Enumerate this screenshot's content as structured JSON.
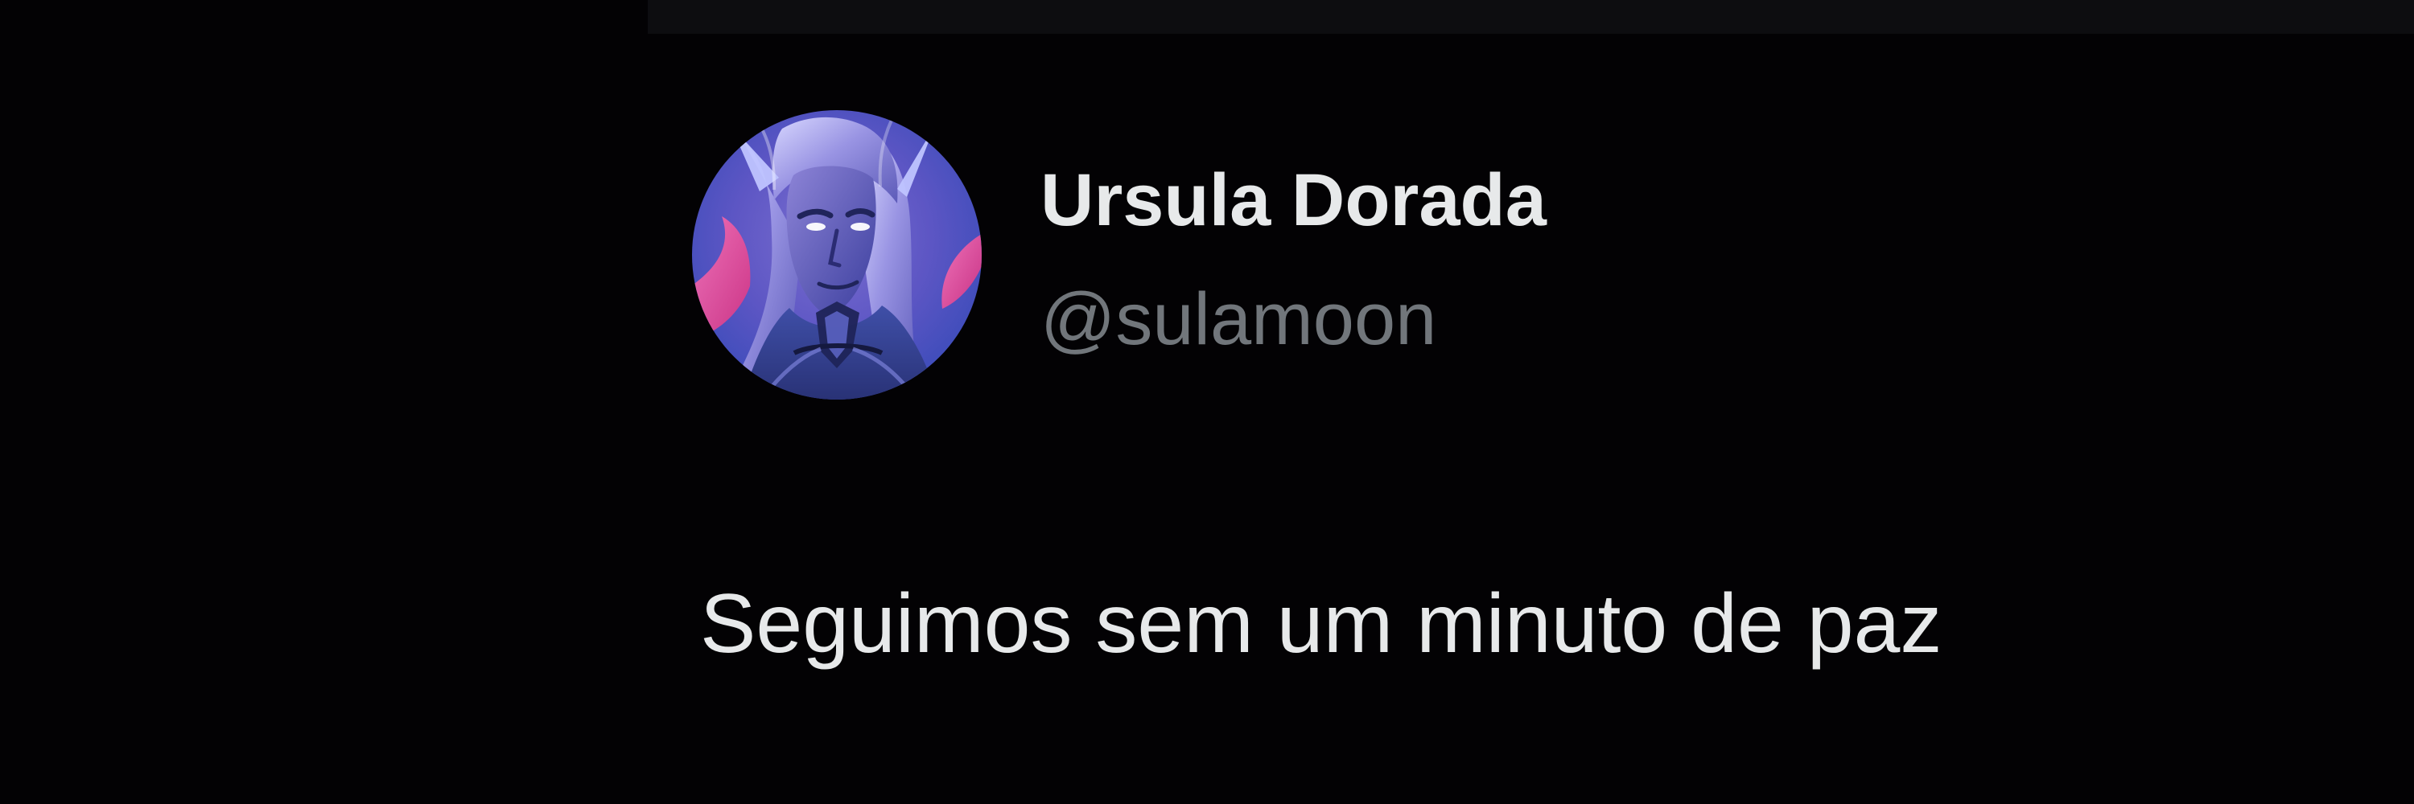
{
  "tweet": {
    "author": {
      "display_name": "Ursula Dorada",
      "handle": "@sulamoon",
      "avatar": "profile-portrait-icon"
    },
    "text": "Seguimos sem um minuto de paz"
  },
  "colors": {
    "background": "#030204",
    "primary_text": "#e7e9ea",
    "secondary_text": "#71767b",
    "avatar_blue": "#4d55bf",
    "avatar_pink": "#f04c9a"
  }
}
